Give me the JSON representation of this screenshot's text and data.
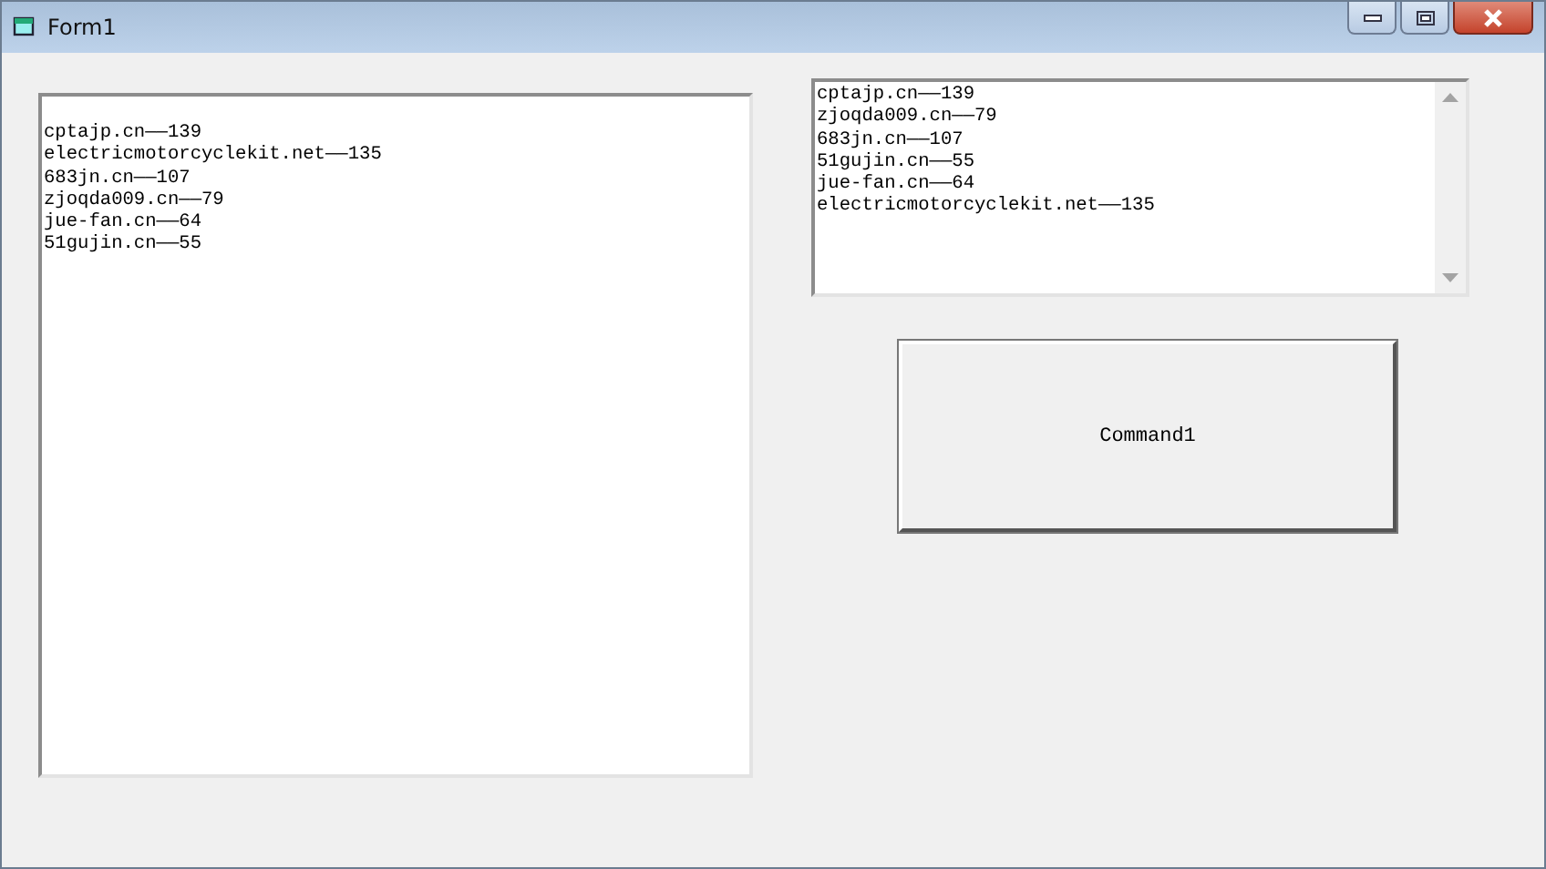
{
  "window": {
    "title": "Form1"
  },
  "text_box": {
    "lines": [
      "cptajp.cn——139",
      "electricmotorcyclekit.net——135",
      "683jn.cn——107",
      "zjoqda009.cn——79",
      "jue-fan.cn——64",
      "51gujin.cn——55"
    ]
  },
  "list_box": {
    "items": [
      "cptajp.cn——139",
      "zjoqda009.cn——79",
      "683jn.cn——107",
      "51gujin.cn——55",
      "jue-fan.cn——64",
      "electricmotorcyclekit.net——135"
    ]
  },
  "button": {
    "label": "Command1"
  }
}
